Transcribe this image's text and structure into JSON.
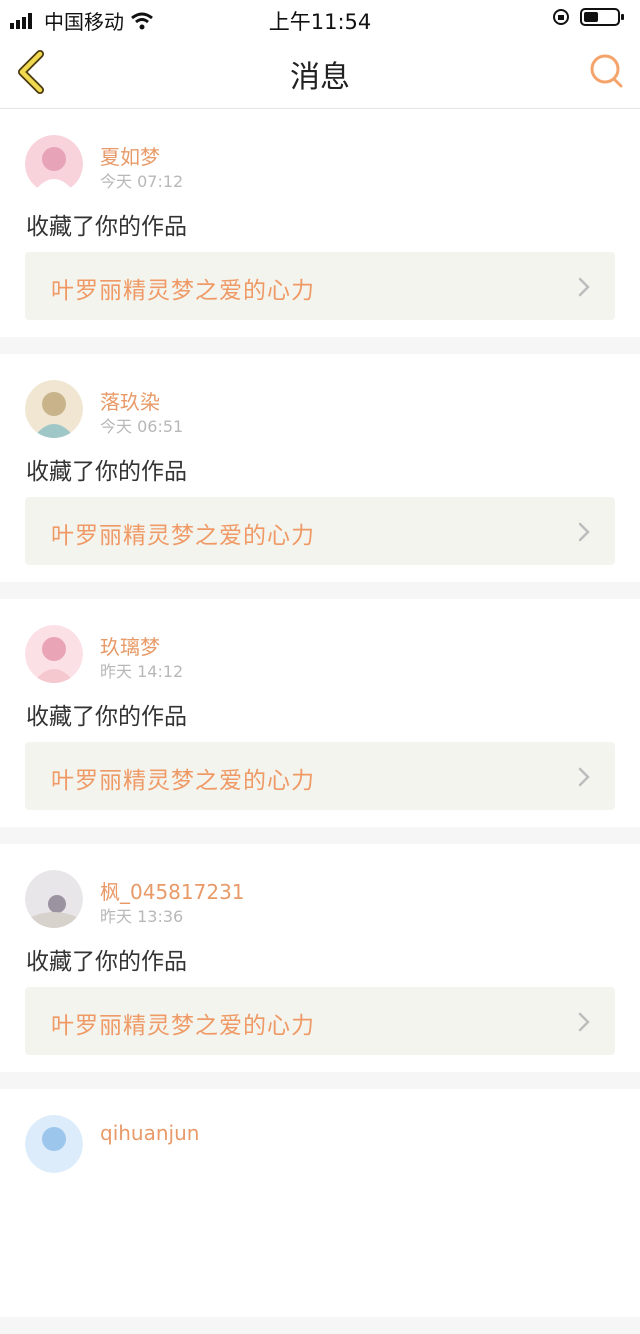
{
  "status_bar": {
    "carrier": "中国移动",
    "time": "上午11:54",
    "icons": [
      "signal-icon",
      "wifi-icon",
      "orientation-lock-icon",
      "battery-icon"
    ]
  },
  "nav": {
    "title": "消息",
    "back_icon": "back-chevron-icon",
    "search_icon": "search-icon",
    "accent_color": "#f4a46a"
  },
  "messages": [
    {
      "user": "夏如梦",
      "time": "今天 07:12",
      "action": "收藏了你的作品",
      "work": "叶罗丽精灵梦之爱的心力",
      "avatar_colors": [
        "#f9d3dc",
        "#e7a3b8"
      ]
    },
    {
      "user": "落玖染",
      "time": "今天 06:51",
      "action": "收藏了你的作品",
      "work": "叶罗丽精灵梦之爱的心力",
      "avatar_colors": [
        "#f0e6d2",
        "#c9b38a"
      ]
    },
    {
      "user": "玖璃梦",
      "time": "昨天 14:12",
      "action": "收藏了你的作品",
      "work": "叶罗丽精灵梦之爱的心力",
      "avatar_colors": [
        "#fbe0e6",
        "#e9a4b6"
      ]
    },
    {
      "user": "枫_045817231",
      "time": "昨天 13:36",
      "action": "收藏了你的作品",
      "work": "叶罗丽精灵梦之爱的心力",
      "avatar_colors": [
        "#e9e6ea",
        "#9b93a0"
      ]
    },
    {
      "user": "qihuanjun",
      "time": "",
      "action": "",
      "work": "",
      "avatar_colors": [
        "#dcecfb",
        "#9cc6ec"
      ]
    }
  ]
}
